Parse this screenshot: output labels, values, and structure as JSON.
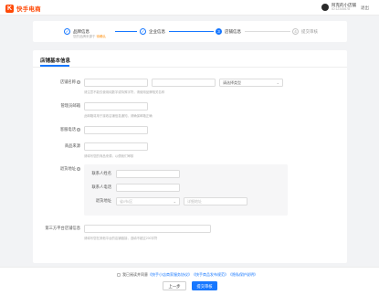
{
  "header": {
    "logo_mark": "K",
    "logo_text": "快手电商",
    "user_name": "阿克的小店铺",
    "user_id": "ID:12345678",
    "logout": "退出"
  },
  "steps": [
    {
      "label": "品牌信息",
      "sub": "您的品牌来源于",
      "sub_warn": "待确认",
      "state": "done",
      "icon": "check-icon"
    },
    {
      "label": "企业信息",
      "state": "done",
      "icon": "check-icon"
    },
    {
      "label": "店铺信息",
      "state": "active",
      "number": "3"
    },
    {
      "label": "提交审核",
      "state": "todo",
      "number": "4"
    }
  ],
  "section": {
    "title": "店铺基本信息"
  },
  "form": {
    "shop_name": {
      "label": "店铺名称",
      "hint": "请注意不能仅使用纯数字或特殊字符，请使用品牌相关名称"
    },
    "shop_type_select": {
      "value": "请选择类型"
    },
    "manager_email": {
      "label": "管理员邮箱",
      "hint": "此邮箱将用于接收店铺信息通知，请确保邮箱正确"
    },
    "contact_phone": {
      "label": "客服电话"
    },
    "sales_channel": {
      "label": "商品来源",
      "hint": "请填写您的商品来源，以便我们审核"
    },
    "return_address": {
      "label": "退货地址",
      "contact_label": "联系人姓名",
      "phone_label": "联系人电话",
      "addr_label": "退货地址",
      "region_value": "省/市/区",
      "detail_placeholder": "详细地址"
    },
    "other_platform": {
      "label": "第三方平台店铺信息",
      "hint": "请填写您在其他平台的店铺链接，选填不超过200字符"
    }
  },
  "footer": {
    "agree_prefix": "我已阅读并同意",
    "links": [
      "《快手小店商家服务协议》",
      "《快手商品发布规范》",
      "《隐私保护说明》"
    ],
    "prev_button": "上一步",
    "submit_button": "提交审核"
  },
  "colors": {
    "brand": "#ff4906",
    "primary": "#1677ff",
    "warn": "#ff8a00"
  }
}
